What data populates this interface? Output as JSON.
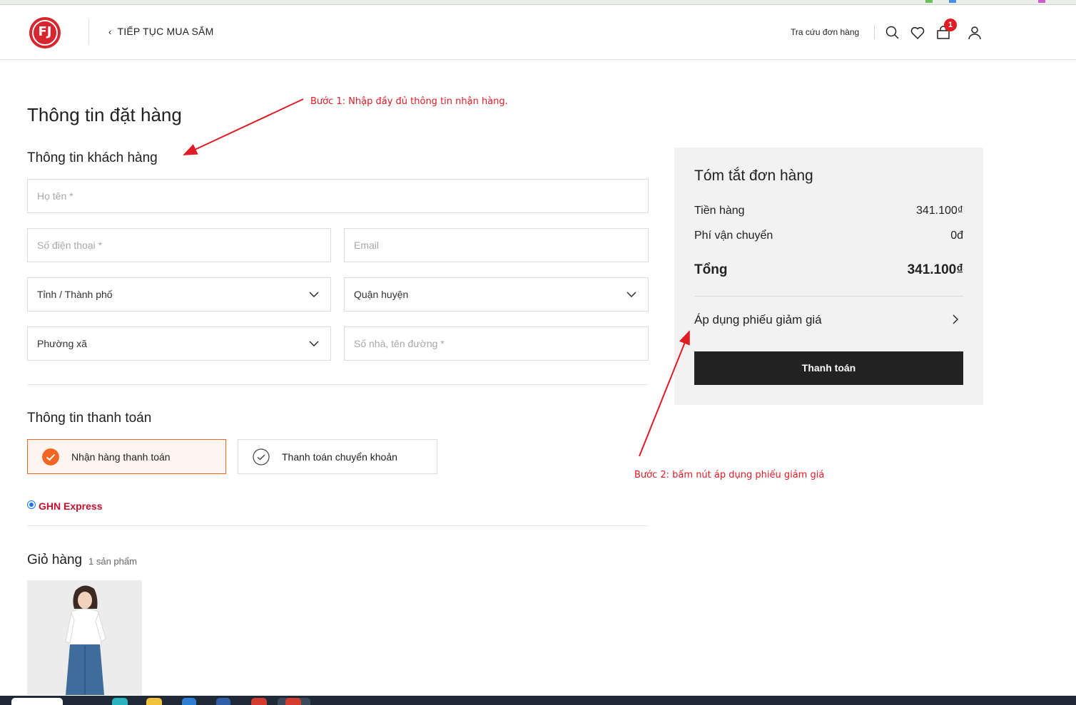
{
  "header": {
    "logo_text": "FJ",
    "back_label": "TIẾP TỤC MUA SẮM",
    "order_lookup": "Tra cứu đơn hàng",
    "cart_badge": "1"
  },
  "page_title": "Thông tin đặt hàng",
  "customer": {
    "title": "Thông tin khách hàng",
    "fields": {
      "name": "Họ tên *",
      "phone": "Số điện thoại *",
      "email": "Email",
      "province": "Tỉnh / Thành phố",
      "district": "Quận huyện",
      "ward": "Phường xã",
      "street": "Số nhà, tên đường *"
    }
  },
  "payment": {
    "title": "Thông tin thanh toán",
    "cod": "Nhận hàng thanh toán",
    "transfer": "Thanh toán chuyển khoản",
    "shipping": "GHN Express"
  },
  "cart": {
    "title": "Giỏ hàng",
    "count": "1 sản phẩm"
  },
  "summary": {
    "title": "Tóm tắt đơn hàng",
    "subtotal_label": "Tiền hàng",
    "subtotal_value": "341.100₫",
    "shipping_label": "Phí vận chuyển",
    "shipping_value": "0đ",
    "total_label": "Tổng",
    "total_value": "341.100₫",
    "coupon_label": "Áp dụng phiếu giảm giá",
    "pay_button": "Thanh toán"
  },
  "annotations": {
    "step1": "Bước 1: Nhập đầy đủ thông tin nhận hàng.",
    "step2": "Bước 2: bấm nút áp dụng phiếu giảm giá"
  },
  "colors": {
    "brand_red": "#d7262e",
    "accent_orange": "#f26522",
    "annotation_red": "#e01b24"
  }
}
